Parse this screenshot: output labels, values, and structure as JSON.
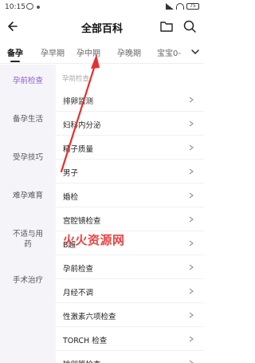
{
  "status_bar": {
    "time": "10:15",
    "battery": "75"
  },
  "header": {
    "title": "全部百科"
  },
  "tabs": [
    {
      "label": "备孕",
      "active": true
    },
    {
      "label": "孕早期",
      "active": false
    },
    {
      "label": "孕中期",
      "active": false
    },
    {
      "label": "孕晚期",
      "active": false
    },
    {
      "label": "宝宝0-",
      "active": false
    }
  ],
  "sidebar": {
    "items": [
      {
        "label": "孕前检查",
        "active": true
      },
      {
        "label": "备孕生活",
        "active": false
      },
      {
        "label": "受孕技巧",
        "active": false
      },
      {
        "label": "难孕难育",
        "active": false
      },
      {
        "label": "不适与用\n药",
        "active": false
      },
      {
        "label": "手术治疗",
        "active": false
      }
    ]
  },
  "content": {
    "category_header": "孕前检查",
    "rows": [
      {
        "label": "排卵监测"
      },
      {
        "label": "妇科内分泌"
      },
      {
        "label": "精子质量"
      },
      {
        "label": "男子"
      },
      {
        "label": "婚检"
      },
      {
        "label": "宫腔镜检查"
      },
      {
        "label": "B超"
      },
      {
        "label": "孕前检查"
      },
      {
        "label": "月经不调"
      },
      {
        "label": "性激素六项检查"
      },
      {
        "label": "TORCH 检查"
      },
      {
        "label": "输卵管检查"
      }
    ]
  },
  "watermark": {
    "text": "火火资源网"
  },
  "colors": {
    "accent": "#8a5fc9",
    "annotation": "#e53030"
  }
}
